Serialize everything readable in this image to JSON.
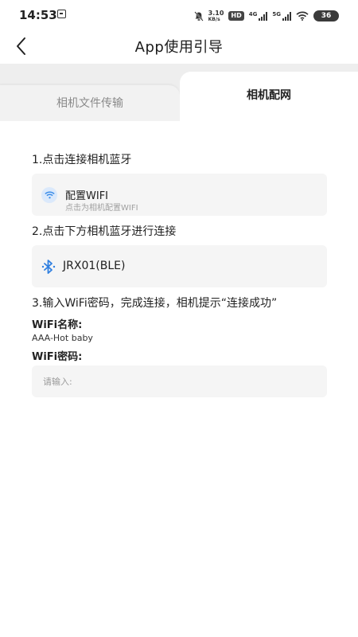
{
  "status_bar": {
    "time": "14:53",
    "net_speed_value": "3.10",
    "net_speed_unit": "KB/s",
    "hd_badge": "HD",
    "signal1_label": "4G",
    "signal2_label": "5G",
    "battery": "36"
  },
  "header": {
    "title": "App使用引导"
  },
  "tabs": [
    {
      "label": "相机文件传输",
      "active": false
    },
    {
      "label": "相机配网",
      "active": true
    }
  ],
  "steps": {
    "step1": "1.点击连接相机蓝牙",
    "step2": "2.点击下方相机蓝牙进行连接",
    "step3": "3.输入WiFi密码，完成连接，相机提示“连接成功”"
  },
  "wifi_card": {
    "title": "配置WIFI",
    "subtitle": "点击为相机配置WIFI"
  },
  "ble_device": {
    "name": "JRX01(BLE)"
  },
  "wifi_name": {
    "label": "WiFi名称:",
    "value": "AAA-Hot baby"
  },
  "wifi_password": {
    "label": "WiFi密码:",
    "placeholder": "请输入:",
    "value": ""
  },
  "colors": {
    "accent_blue": "#3d8ee8",
    "bluetooth_blue": "#2f7fe0",
    "card_bg": "#f5f5f5"
  }
}
